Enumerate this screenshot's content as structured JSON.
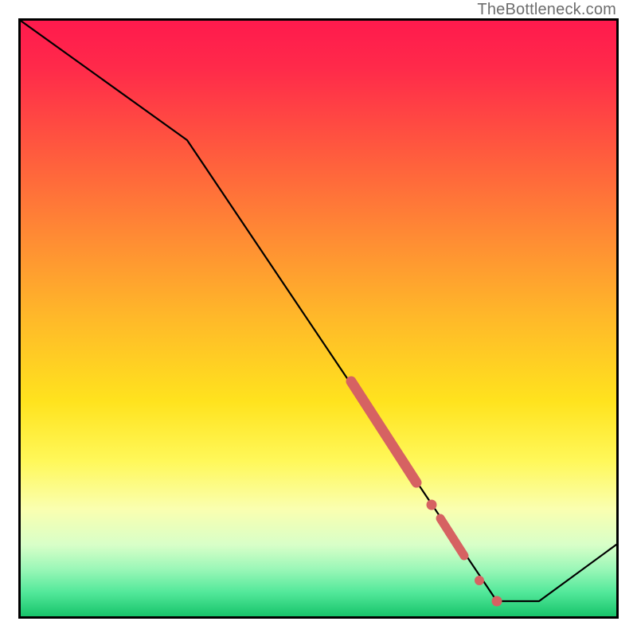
{
  "watermark": "TheBottleneck.com",
  "chart_data": {
    "type": "line",
    "x": [
      0.0,
      0.28,
      0.8,
      0.87,
      1.0
    ],
    "y": [
      1.0,
      0.8,
      0.025,
      0.025,
      0.12
    ],
    "highlight_segments": [
      {
        "kind": "thick",
        "x0": 0.555,
        "y0": 0.395,
        "x1": 0.665,
        "y1": 0.225
      },
      {
        "kind": "dot",
        "cx": 0.69,
        "cy": 0.187
      },
      {
        "kind": "thick",
        "x0": 0.705,
        "y0": 0.165,
        "x1": 0.745,
        "y1": 0.102
      },
      {
        "kind": "dot",
        "cx": 0.77,
        "cy": 0.06
      },
      {
        "kind": "dot",
        "cx": 0.8,
        "cy": 0.025
      }
    ],
    "colors": {
      "line": "#000000",
      "highlight": "#d66262",
      "gradient_top": "#ff1a4d",
      "gradient_bottom": "#18c46a"
    },
    "xlim": [
      0,
      1
    ],
    "ylim": [
      0,
      1
    ],
    "title": "",
    "xlabel": "",
    "ylabel": ""
  }
}
